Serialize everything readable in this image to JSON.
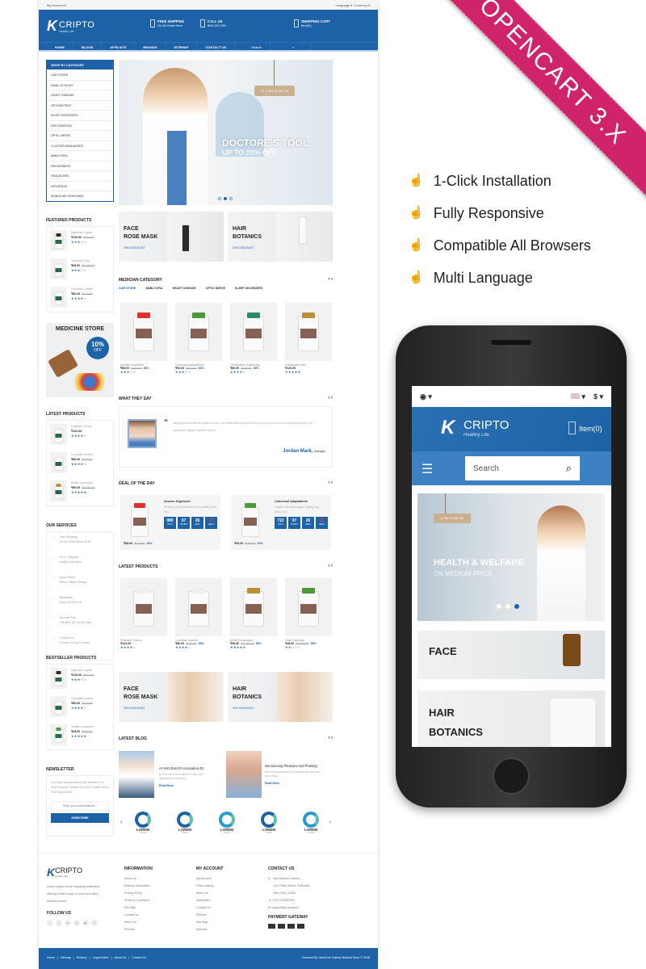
{
  "colors": {
    "brand": "#1d62a6",
    "ribbon": "#d0246a"
  },
  "topbar": {
    "account": "My Account ▾",
    "language": "Language ▾",
    "currency": "Currency ▾"
  },
  "header": {
    "logo": "CRIPTO",
    "tagline": "Healthy Life",
    "shipping_title": "FREE SHIPPING",
    "shipping_sub": "On All Order Item",
    "call_title": "CALL US",
    "call_sub": "800-243-789",
    "cart_title": "SHOPPING CART",
    "cart_sub": "Item(0)"
  },
  "nav": {
    "items": [
      "HOME",
      "BLOGS",
      "AFFILIATE",
      "BRANDS",
      "SITEMAP",
      "CONTACT US"
    ],
    "search_placeholder": "Search",
    "search_icon": "search-icon"
  },
  "categories": {
    "title": "SHOP BY CATEGORY",
    "items": [
      "OUR STORE",
      "PANIC ATTACKS",
      "HEART DISEASE",
      "OPTOMETRIST",
      "SLEEP DISORDERS",
      "DEHYDRATION",
      "OPTIC NERVE",
      "CLUSTER HEADACHES",
      "AMBLYOPIA",
      "DROWSINESS",
      "HEADACHES",
      "INFLUENZA",
      "MONOXIDE POISONING"
    ]
  },
  "featured": {
    "title": "FEATURED PRODUCTS",
    "items": [
      {
        "name": "Dignissim Ligula",
        "price": "₹116.00",
        "old": "₹122.00",
        "rating": 3,
        "cap": "#3a2a1a"
      },
      {
        "name": "Tincidunt Dolor",
        "price": "₹68.00",
        "old": "₹1,050.00",
        "rating": 3,
        "cap": "#eee"
      },
      {
        "name": "Convallis Laoreet",
        "price": "₹80.00",
        "old": "₹122.00",
        "rating": 4,
        "cap": "#eee"
      }
    ]
  },
  "promo": {
    "title": "MEDICINE STORE",
    "badge_pct": "10%",
    "badge_off": "OFF"
  },
  "latest_side": {
    "title": "LATEST PRODUCTS",
    "items": [
      {
        "name": "Praesent Viverra",
        "price": "₹122.00",
        "old": "",
        "rating": 4,
        "cap": "#eee"
      },
      {
        "name": "Convallis Laoreet",
        "price": "₹80.00",
        "old": "₹122.00",
        "rating": 4,
        "cap": "#eee"
      },
      {
        "name": "Mollis Consequat",
        "price": "₹59.60",
        "old": "₹1,060.00",
        "rating": 5,
        "cap": "#b8923a"
      }
    ]
  },
  "services": {
    "title": "OUR SERVICES",
    "items": [
      {
        "title": "Free Shipping",
        "sub": "On All Order Above $199"
      },
      {
        "title": "24 X 7 Support",
        "sub": "Totally Free Drive"
      },
      {
        "title": "Easy Return",
        "sub": "Return Within 30days"
      },
      {
        "title": "Rewarded",
        "sub": "Enjoy 30-50% Off"
      },
      {
        "title": "Secured Pay",
        "sub": "Flat 60% Off On Sbi Card"
      },
      {
        "title": "Contact Us",
        "sub": "In Case Of Any Concern"
      }
    ]
  },
  "bestseller": {
    "title": "BESTSELLER PRODUCTS",
    "items": [
      {
        "name": "Dignissim Ligula",
        "price": "₹116.00",
        "old": "₹122.00",
        "rating": 3,
        "cap": "#3a2a1a"
      },
      {
        "name": "Convallis Laoreet",
        "price": "₹80.00",
        "old": "₹122.00",
        "rating": 4,
        "cap": "#eee"
      },
      {
        "name": "Vestibu Lumporta",
        "price": "₹68.00",
        "old": "₹602.00",
        "rating": 5,
        "cap": "#4a9a3a"
      }
    ]
  },
  "newsletter": {
    "title": "NEWSLETTER",
    "text": "You May Unsubscribe At Any Moment. For That Purpose, Please Find Our Contact Info In The Legal Notice.",
    "placeholder": "Enter your email address...",
    "button": "SUBSCRIBE"
  },
  "hero": {
    "phone": "(+91) 23 567 80",
    "title": "DOCTORE'S TOOL",
    "subtitle": "UP TO 20% OFF",
    "slide": 2,
    "slides": 3
  },
  "banners_top": [
    {
      "line1": "FACE",
      "line2": "ROSE MASK",
      "discount": "25% DISCOUNT"
    },
    {
      "line1": "HAIR",
      "line2": "BOTANICS",
      "discount": "20% DISCOUNT"
    }
  ],
  "medician": {
    "title": "MEDICIAN CATEGORY",
    "tabs": [
      "OUR STORE",
      "AMBLYOPIA",
      "HEART DISEASE",
      "OPTIC NERVE",
      "SLEEP DISORDERS"
    ],
    "active_tab": 0,
    "items": [
      {
        "name": "Aenean Dignissim",
        "price": "₹68.00",
        "old": "₹123.00",
        "disc": "46%",
        "rating": 3,
        "cap": "#e03030"
      },
      {
        "name": "Canonical Adaptations",
        "price": "₹92.00",
        "old": "₹242.00",
        "disc": "63%",
        "rating": 3,
        "cap": "#4a9a3a"
      },
      {
        "name": "Consectetur Adipiscing",
        "price": "₹80.00",
        "old": "₹122.00",
        "disc": "35%",
        "rating": 4,
        "cap": "#2a8a6a"
      },
      {
        "name": "Consequat Nibh",
        "price": "₹122.00",
        "old": "",
        "disc": "",
        "rating": 5,
        "cap": "#b8923a"
      }
    ]
  },
  "testimonial": {
    "title": "WHAT THEY SAY",
    "text": "Majority have suffered injected humor ods believable ed injected humor ed injected humor ed injected humor ed injecteded injected injected humor.",
    "name": "Jordan Mark,",
    "role": "Manager"
  },
  "deal": {
    "title": "DEAL OF THE DAY",
    "items": [
      {
        "name": "Aenean Dignissim",
        "desc": "iPhone is a revolutionary new mobile phone that",
        "days": "980",
        "hours": "07",
        "mins": "26",
        "secs": "33",
        "price": "₹68.00",
        "old": "₹123.00",
        "disc": "46%",
        "cap": "#e03030"
      },
      {
        "name": "Canonical Adaptations",
        "desc": "Imagine the advantages of going big without slo",
        "days": "722",
        "hours": "07",
        "mins": "26",
        "secs": "33",
        "price": "₹92.00",
        "old": "₹242.00",
        "disc": "62%",
        "cap": "#4a9a3a"
      }
    ],
    "labels": {
      "days": "DAYS",
      "hours": "HOURS",
      "mins": "MINS",
      "secs": "SECS"
    }
  },
  "latest": {
    "title": "LATEST PRODUCTS",
    "items": [
      {
        "name": "Praesent Viverra",
        "price": "₹122.00",
        "old": "",
        "disc": "",
        "rating": 4,
        "cap": "#eee"
      },
      {
        "name": "Convallis Laoreet",
        "price": "₹80.00",
        "old": "₹122.00",
        "disc": "35%",
        "rating": 4,
        "cap": "#eee"
      },
      {
        "name": "Mollis Consequat",
        "price": "₹59.60",
        "old": "₹1,060.00",
        "disc": "95%",
        "rating": 5,
        "cap": "#b8923a"
      },
      {
        "name": "Vitae Faucibus",
        "price": "₹48.00",
        "old": "₹2,000.00",
        "disc": "98%",
        "rating": 2,
        "cap": "#4a9a3a"
      }
    ]
  },
  "banners_mid": [
    {
      "line1": "FACE",
      "line2": "ROSE MASK",
      "discount": "25% DISCOUNT"
    },
    {
      "line1": "HAIR",
      "line2": "BOTANICS",
      "discount": "20% DISCOUNT"
    }
  ],
  "blog": {
    "title": "LATEST BLOG",
    "items": [
      {
        "title": "At Vero Eos Et Accusamus Et",
        "excerpt": "At vero eos et accusamus et iusto odio dignissimos ducimus q...",
        "more": "Read More"
      },
      {
        "title": "Denouncing Pleasure And Praising",
        "excerpt": "denouncing pleasure and praising pain was born and I will gi...",
        "more": "Read More"
      }
    ]
  },
  "brands": {
    "items": [
      "LOREM",
      "LOREM",
      "LOREM",
      "LOREM",
      "LOREM"
    ],
    "sub": "IPSUM"
  },
  "footer": {
    "about": "India's largest home shopping destination offering a wide range of home and office furniture online.",
    "follow": "FOLLOW US",
    "social": [
      "f",
      "t",
      "G+",
      "◎",
      "▶",
      "ℕ"
    ],
    "info": {
      "title": "INFORMATION",
      "links": [
        "About Us",
        "Delivery Information",
        "Privacy Policy",
        "Terms & Conditions",
        "Site Map",
        "Contact Us",
        "Wish List",
        "Returns"
      ]
    },
    "account": {
      "title": "MY ACCOUNT",
      "links": [
        "My Account",
        "Order History",
        "Wish List",
        "Newsletter",
        "Contact Us",
        "Returns",
        "Site Map",
        "Specials"
      ]
    },
    "contact": {
      "title": "CONTACT US",
      "address": [
        "Mlc Fashion Clothes.",
        "111, Puffin Street, Puffinville,",
        "New York, 12356"
      ],
      "phone": "+00 1234567890",
      "email": "support@yourshop.in"
    },
    "payment": "PAYMENT GATEWAY",
    "bottom_links": [
      "Home",
      "Sitemap",
      "Delivery",
      "Legal Notice",
      "About Us",
      "Contact Us"
    ],
    "powered": "Powered By OpenCart Criptop Medical Store © 2018"
  },
  "ribbon": "OPENCART 3.X",
  "features": [
    "1-Click Installation",
    "Fully Responsive",
    "Compatible All Browsers",
    "Multi Language"
  ],
  "mobile": {
    "currency": "$",
    "logo": "CRIPTO",
    "tagline": "Healthy Life",
    "cart": "Item(0)",
    "search_placeholder": "Search",
    "hero_title": "HEALTH & WELFARE",
    "hero_sub": "ON MEDIUM PRICE",
    "hero_phone": "(+91) 23 567 80",
    "banner1": "FACE",
    "banner2_l1": "HAIR",
    "banner2_l2": "BOTANICS"
  }
}
